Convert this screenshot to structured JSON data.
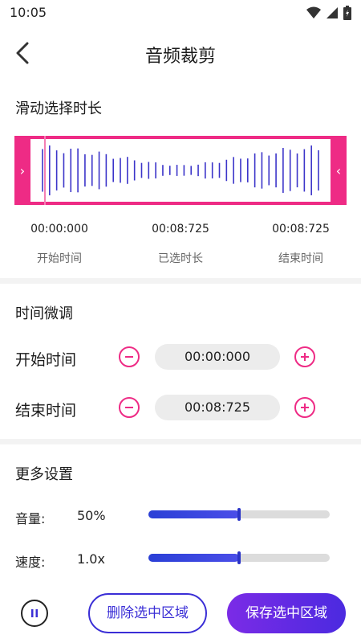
{
  "status_bar": {
    "time": "10:05",
    "icons": [
      "wifi-icon",
      "signal-icon",
      "battery-icon"
    ]
  },
  "header": {
    "back_icon": "chevron-left-icon",
    "title": "音频裁剪"
  },
  "slide_section": {
    "title": "滑动选择时长",
    "start_time": "00:00:000",
    "selected_duration": "00:08:725",
    "end_time": "00:08:725",
    "start_label": "开始时间",
    "duration_label": "已选时长",
    "end_label": "结束时间",
    "left_handle": "›",
    "right_handle": "‹"
  },
  "fine_tune": {
    "title": "时间微调",
    "start_label": "开始时间",
    "start_value": "00:00:000",
    "end_label": "结束时间",
    "end_value": "00:08:725"
  },
  "more_settings": {
    "title": "更多设置",
    "volume_label": "音量:",
    "volume_value": "50%",
    "volume_level": 0.5,
    "speed_label": "速度:",
    "speed_value": "1.0x",
    "speed_level": 0.5
  },
  "bottom": {
    "pause_icon": "pause-icon",
    "delete_label": "删除选中区域",
    "save_label": "保存选中区域"
  },
  "colors": {
    "accent_pink": "#ee2b85",
    "accent_blue": "#3a2ed6",
    "wave_bar": "#3b34c9"
  }
}
